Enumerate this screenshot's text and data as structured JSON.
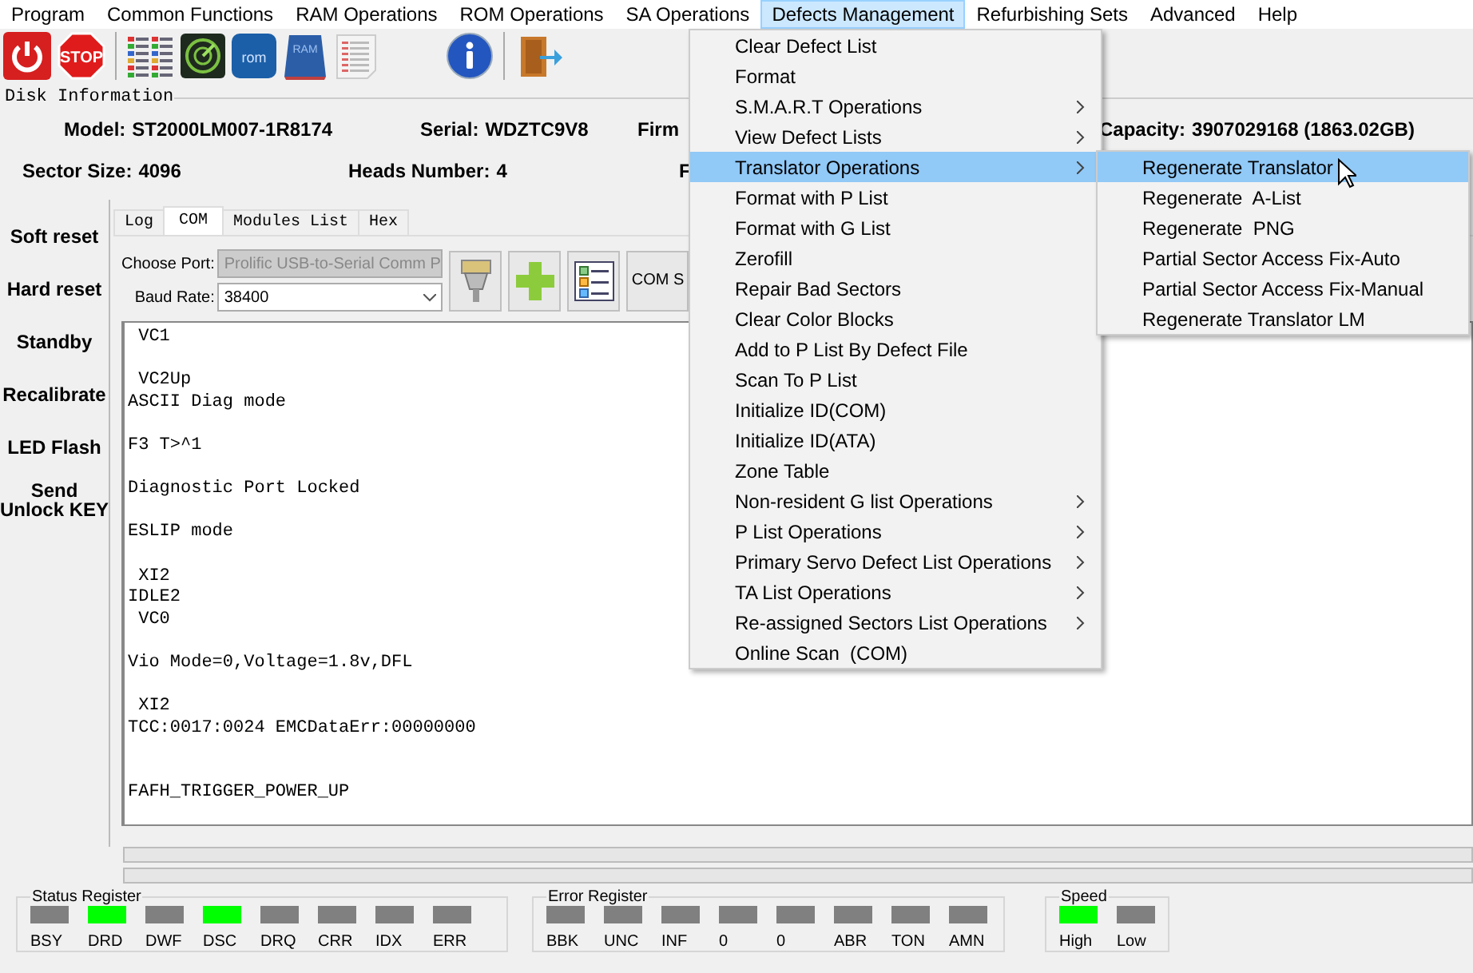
{
  "menubar": [
    {
      "label": "Program",
      "selected": false
    },
    {
      "label": "Common Functions",
      "selected": false
    },
    {
      "label": "RAM Operations",
      "selected": false
    },
    {
      "label": "ROM Operations",
      "selected": false
    },
    {
      "label": "SA Operations",
      "selected": false
    },
    {
      "label": "Defects Management",
      "selected": true
    },
    {
      "label": "Refurbishing Sets",
      "selected": false
    },
    {
      "label": "Advanced",
      "selected": false
    },
    {
      "label": "Help",
      "selected": false
    }
  ],
  "toolbar": [
    {
      "kind": "power"
    },
    {
      "kind": "stop",
      "label": "STOP"
    },
    {
      "kind": "separator"
    },
    {
      "kind": "list"
    },
    {
      "kind": "radar"
    },
    {
      "kind": "rom",
      "label": "rom"
    },
    {
      "kind": "ram",
      "label": "RAM"
    },
    {
      "kind": "sheet"
    },
    {
      "kind": "spacer"
    },
    {
      "kind": "info"
    },
    {
      "kind": "separator"
    },
    {
      "kind": "exit"
    }
  ],
  "disk_info": {
    "title": "Disk Information",
    "rows": [
      [
        {
          "label": "Model:",
          "value": "ST2000LM007-1R8174"
        },
        {
          "label": "Serial:",
          "value": "WDZTC9V8"
        },
        {
          "label": "Firm"
        },
        {
          "label": "Capacity:",
          "value": "3907029168 (1863.02GB)"
        }
      ],
      [
        {
          "label": "Sector Size:",
          "value": "4096"
        },
        {
          "label": "Heads Number:",
          "value": "4"
        },
        {
          "label": "F"
        }
      ]
    ]
  },
  "sidebar_buttons": [
    "Soft reset",
    "Hard reset",
    "Standby",
    "Recalibrate",
    "LED Flash",
    "Send Unlock KEY"
  ],
  "tabs": [
    {
      "label": "Log",
      "selected": false
    },
    {
      "label": "COM",
      "selected": true
    },
    {
      "label": "Modules List",
      "selected": false
    },
    {
      "label": "Hex",
      "selected": false
    }
  ],
  "com": {
    "port_label": "Choose Port:",
    "port_value": "Prolific USB-to-Serial Comm P",
    "port_disabled": true,
    "baud_label": "Baud Rate:",
    "baud_value": "38400",
    "tools": [
      {
        "kind": "connector"
      },
      {
        "kind": "plus"
      },
      {
        "kind": "list"
      },
      {
        "kind": "text",
        "label": "COM S"
      }
    ]
  },
  "console_text": " VC1\n\n VC2Up\nASCII Diag mode\n\nF3 T>^1\n\nDiagnostic Port Locked\n\nESLIP mode\n\n XI2\nIDLE2\n VC0\n\nVio Mode=0,Voltage=1.8v,DFL\n\n XI2\nTCC:0017:0024 EMCDataErr:00000000\n\n\nFAFH_TRIGGER_POWER_UP",
  "progress_bars": [
    {
      "level": 0
    },
    {
      "level": 0
    }
  ],
  "registers": [
    {
      "title": "Status Register",
      "leds": [
        {
          "label": "BSY",
          "on": false
        },
        {
          "label": "DRD",
          "on": true
        },
        {
          "label": "DWF",
          "on": false
        },
        {
          "label": "DSC",
          "on": true
        },
        {
          "label": "DRQ",
          "on": false
        },
        {
          "label": "CRR",
          "on": false
        },
        {
          "label": "IDX",
          "on": false
        },
        {
          "label": "ERR",
          "on": false
        }
      ]
    },
    {
      "title": "Error Register",
      "leds": [
        {
          "label": "BBK",
          "on": false
        },
        {
          "label": "UNC",
          "on": false
        },
        {
          "label": "INF",
          "on": false
        },
        {
          "label": "0",
          "on": false
        },
        {
          "label": "0",
          "on": false
        },
        {
          "label": "ABR",
          "on": false
        },
        {
          "label": "TON",
          "on": false
        },
        {
          "label": "AMN",
          "on": false
        }
      ]
    },
    {
      "title": "Speed",
      "leds": [
        {
          "label": "High",
          "on": true
        },
        {
          "label": "Low",
          "on": false
        }
      ]
    }
  ],
  "menu": {
    "items": [
      {
        "label": "Clear Defect List",
        "has_submenu": false,
        "selected": false
      },
      {
        "label": "Format",
        "has_submenu": false,
        "selected": false
      },
      {
        "label": "S.M.A.R.T Operations",
        "has_submenu": true,
        "selected": false
      },
      {
        "label": "View Defect Lists",
        "has_submenu": true,
        "selected": false
      },
      {
        "label": "Translator Operations",
        "has_submenu": true,
        "selected": true
      },
      {
        "label": "Format with P List",
        "has_submenu": false,
        "selected": false
      },
      {
        "label": "Format with G List",
        "has_submenu": false,
        "selected": false
      },
      {
        "label": "Zerofill",
        "has_submenu": false,
        "selected": false
      },
      {
        "label": "Repair Bad Sectors",
        "has_submenu": false,
        "selected": false
      },
      {
        "label": "Clear Color Blocks",
        "has_submenu": false,
        "selected": false
      },
      {
        "label": "Add to P List By Defect File",
        "has_submenu": false,
        "selected": false
      },
      {
        "label": "Scan To P List",
        "has_submenu": false,
        "selected": false
      },
      {
        "label": "Initialize ID(COM)",
        "has_submenu": false,
        "selected": false
      },
      {
        "label": "Initialize ID(ATA)",
        "has_submenu": false,
        "selected": false
      },
      {
        "label": "Zone Table",
        "has_submenu": false,
        "selected": false
      },
      {
        "label": "Non-resident G list Operations",
        "has_submenu": true,
        "selected": false
      },
      {
        "label": "P List Operations",
        "has_submenu": true,
        "selected": false
      },
      {
        "label": "Primary Servo Defect List Operations",
        "has_submenu": true,
        "selected": false
      },
      {
        "label": "TA List Operations",
        "has_submenu": true,
        "selected": false
      },
      {
        "label": "Re-assigned Sectors List Operations",
        "has_submenu": true,
        "selected": false
      },
      {
        "label": "Online Scan  (COM)",
        "has_submenu": false,
        "selected": false
      }
    ],
    "submenu": [
      {
        "label": "Regenerate Translator",
        "selected": true
      },
      {
        "label": "Regenerate  A-List",
        "selected": false
      },
      {
        "label": "Regenerate  PNG",
        "selected": false
      },
      {
        "label": "Partial Sector Access Fix-Auto",
        "selected": false
      },
      {
        "label": "Partial Sector Access Fix-Manual",
        "selected": false
      },
      {
        "label": "Regenerate Translator LM",
        "selected": false
      }
    ]
  }
}
